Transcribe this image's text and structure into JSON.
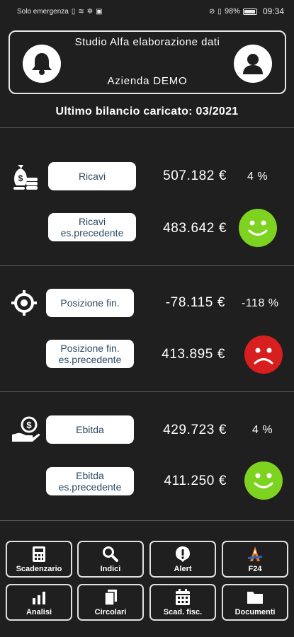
{
  "status_bar": {
    "carrier": "Solo emergenza",
    "battery": "98%",
    "time": "09:34"
  },
  "header": {
    "studio": "Studio Alfa elaborazione dati",
    "company": "Azienda DEMO",
    "bell_icon": "bell-icon",
    "user_icon": "user-icon"
  },
  "subtitle": "Ultimo bilancio caricato: 03/2021",
  "sections": [
    {
      "icon": "money-bags-icon",
      "current_label": "Ricavi",
      "current_value": "507.182 €",
      "change": "4 %",
      "previous_label": "Ricavi es.precedente",
      "previous_value": "483.642 €",
      "mood": "happy"
    },
    {
      "icon": "target-icon",
      "current_label": "Posizione fin.",
      "current_value": "-78.115 €",
      "change": "-118 %",
      "previous_label": "Posizione fin. es.precedente",
      "previous_value": "413.895 €",
      "mood": "sad"
    },
    {
      "icon": "hand-coin-icon",
      "current_label": "Ebitda",
      "current_value": "429.723 €",
      "change": "4 %",
      "previous_label": "Ebitda es.precedente",
      "previous_value": "411.250 €",
      "mood": "happy"
    }
  ],
  "colors": {
    "good": "#7ed321",
    "bad": "#d81f1f",
    "pill_text": "#2d4a63"
  },
  "nav": [
    {
      "label": "Scadenzario",
      "icon": "calculator-icon"
    },
    {
      "label": "Indici",
      "icon": "search-icon"
    },
    {
      "label": "Alert",
      "icon": "alert-icon"
    },
    {
      "label": "F24",
      "icon": "f24-logo-icon"
    },
    {
      "label": "Analisi",
      "icon": "bar-chart-icon"
    },
    {
      "label": "Circolari",
      "icon": "documents-icon"
    },
    {
      "label": "Scad. fisc.",
      "icon": "calendar-icon"
    },
    {
      "label": "Documenti",
      "icon": "folder-icon"
    }
  ]
}
